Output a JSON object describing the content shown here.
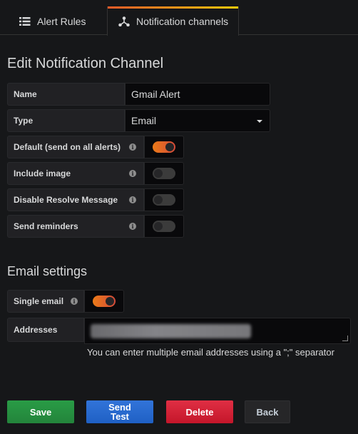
{
  "tabs": [
    {
      "label": "Alert Rules",
      "icon": "list-icon",
      "active": false
    },
    {
      "label": "Notification channels",
      "icon": "share-network-icon",
      "active": true
    }
  ],
  "page_title": "Edit Notification Channel",
  "fields": {
    "name": {
      "label": "Name",
      "value": "Gmail Alert"
    },
    "type": {
      "label": "Type",
      "value": "Email"
    }
  },
  "toggles": [
    {
      "label": "Default (send on all alerts)",
      "on": true
    },
    {
      "label": "Include image",
      "on": false
    },
    {
      "label": "Disable Resolve Message",
      "on": false
    },
    {
      "label": "Send reminders",
      "on": false
    }
  ],
  "email_settings": {
    "title": "Email settings",
    "single_email": {
      "label": "Single email",
      "on": true
    },
    "addresses": {
      "label": "Addresses",
      "value": "(blurred email address)"
    },
    "hint": "You can enter multiple email addresses using a \";\" separator"
  },
  "buttons": {
    "save": "Save",
    "send_test": "Send Test",
    "delete": "Delete",
    "back": "Back"
  },
  "info_glyph": "i"
}
